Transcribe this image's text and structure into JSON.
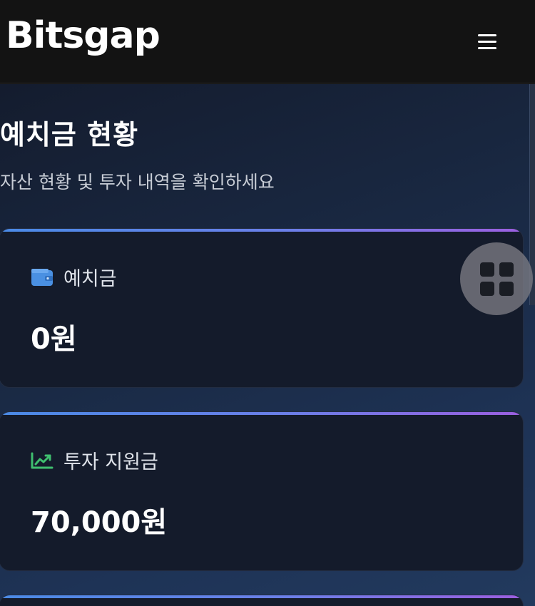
{
  "header": {
    "logo": "Bitsgap"
  },
  "page": {
    "title": "예치금 현황",
    "subtitle": "자산 현황 및 투자 내역을 확인하세요"
  },
  "cards": [
    {
      "label": "예치금",
      "value": "0원",
      "icon": "wallet-icon"
    },
    {
      "label": "투자 지원금",
      "value": "70,000원",
      "icon": "trending-up-icon"
    }
  ],
  "colors": {
    "header_bg": "#131313",
    "card_bg": "#141b2b",
    "accent_start": "#4a8ae6",
    "accent_end": "#9b5fe0",
    "wallet_icon": "#4a90e2",
    "trend_icon": "#3fbf6f"
  }
}
